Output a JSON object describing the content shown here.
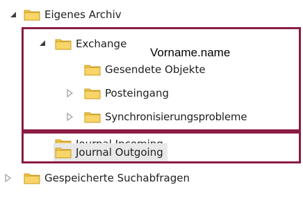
{
  "tree": {
    "root": {
      "label": "Eigenes Archiv",
      "expanded": true
    },
    "exchange": {
      "label": "Exchange",
      "expanded": true,
      "annotation": "Vorname.name"
    },
    "children": [
      {
        "label": "Gesendete Objekte",
        "has_children": false
      },
      {
        "label": "Posteingang",
        "has_children": true
      },
      {
        "label": "Synchronisierungsprobleme",
        "has_children": true
      }
    ],
    "journal_incoming": {
      "label": "Journal Incoming"
    },
    "journal_outgoing": {
      "label": "Journal Outgoing",
      "selected": true
    },
    "saved_searches": {
      "label": "Gespeicherte Suchabfragen",
      "has_children": true
    }
  },
  "colors": {
    "frame": "#8a1b45",
    "folder_body": "#f3c94f",
    "folder_edge": "#c99a1e",
    "selection": "#e8e8e8",
    "expanded_arrow": "#3c3c3c",
    "collapsed_arrow": "#9a9a9a"
  },
  "icons": {
    "expanded": "triangle-down-right-icon",
    "collapsed": "triangle-right-outline-icon",
    "folder": "folder-icon"
  }
}
